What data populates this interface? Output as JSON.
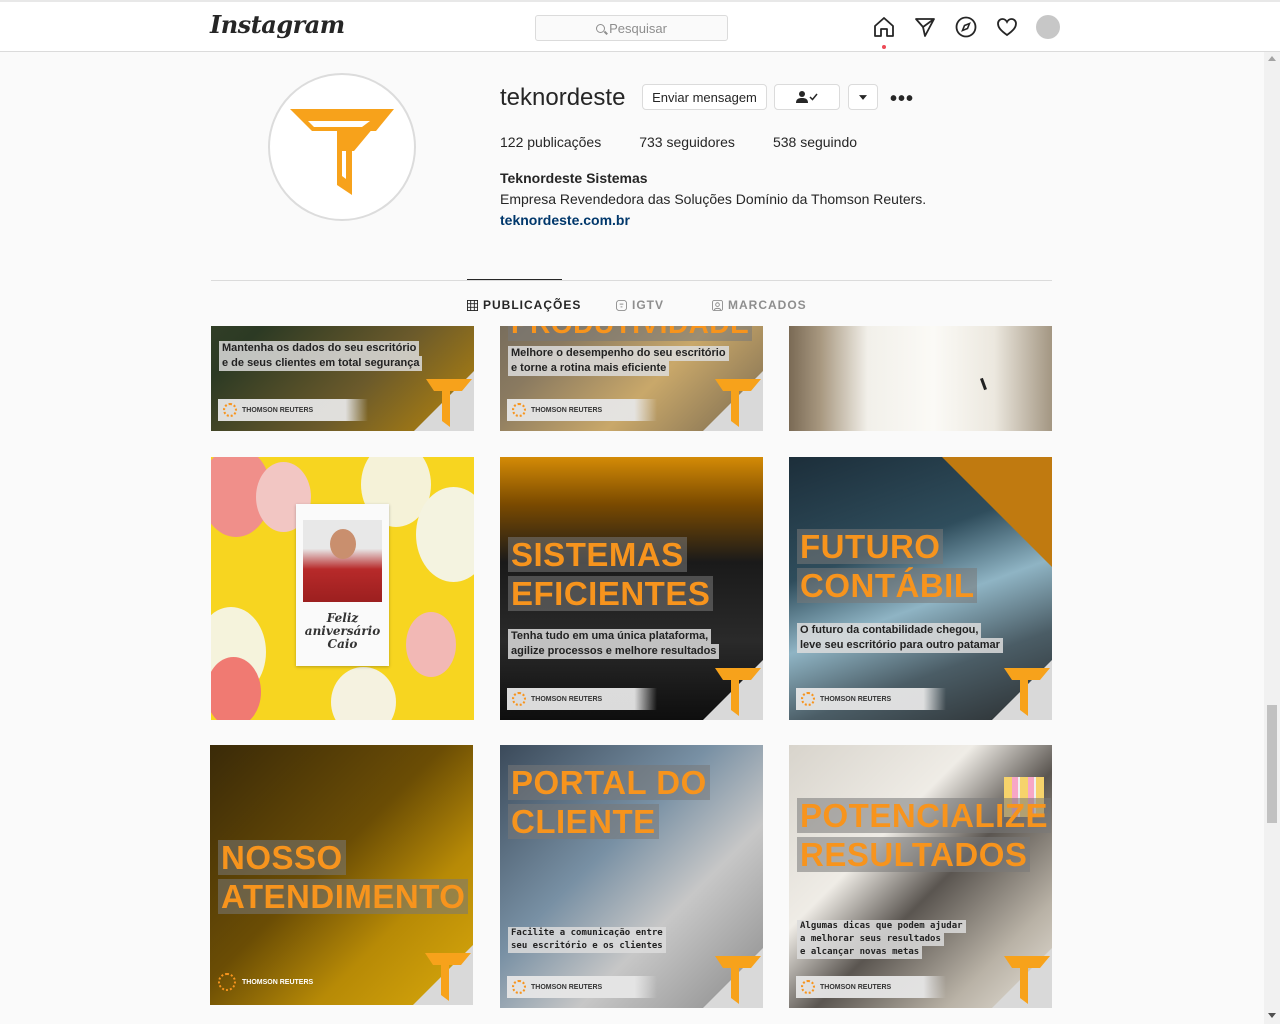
{
  "nav": {
    "logo": "Instagram",
    "search_placeholder": "Pesquisar",
    "icons": [
      "home-icon",
      "direct-icon",
      "explore-icon",
      "heart-icon",
      "profile-avatar"
    ]
  },
  "profile": {
    "username": "teknordeste",
    "message_button": "Enviar mensagem",
    "stats": {
      "posts_count": "122",
      "posts_label": "publicações",
      "followers_count": "733",
      "followers_label": "seguidores",
      "following_count": "538",
      "following_label": "seguindo"
    },
    "full_name": "Teknordeste Sistemas",
    "bio": "Empresa Revendedora das Soluções Domínio da Thomson Reuters.",
    "website": "teknordeste.com.br"
  },
  "tabs": [
    {
      "label": "PUBLICAÇÕES",
      "active": true
    },
    {
      "label": "IGTV",
      "active": false
    },
    {
      "label": "MARCADOS",
      "active": false
    }
  ],
  "brand": {
    "orange": "#f7941d",
    "tr_label": "THOMSON REUTERS"
  },
  "posts": [
    {
      "title": [],
      "subtitle": [
        "Mantenha os dados do seu escritório",
        "e de seus clientes em total segurança"
      ]
    },
    {
      "title": [
        "PRODUTIVIDADE"
      ],
      "subtitle": [
        "Melhore o desempenho do seu escritório",
        "e torne a rotina mais eficiente"
      ]
    },
    {
      "title": [],
      "subtitle": []
    },
    {
      "title": [],
      "subtitle": [],
      "card_text": [
        "Feliz",
        "aniversário",
        "Caio"
      ]
    },
    {
      "title": [
        "SISTEMAS",
        "EFICIENTES"
      ],
      "subtitle": [
        "Tenha tudo em uma única plataforma,",
        "agilize processos e melhore resultados"
      ]
    },
    {
      "title": [
        "FUTURO",
        "CONTÁBIL"
      ],
      "subtitle": [
        "O futuro da contabilidade chegou,",
        "leve seu escritório para outro patamar"
      ]
    },
    {
      "title": [
        "NOSSO",
        "ATENDIMENTO"
      ],
      "subtitle": []
    },
    {
      "title": [
        "PORTAL DO",
        "CLIENTE"
      ],
      "subtitle": [
        "Facilite a comunicação entre",
        "seu escritório e os clientes"
      ]
    },
    {
      "title": [
        "POTENCIALIZE",
        "RESULTADOS"
      ],
      "subtitle": [
        "Algumas dicas que podem ajudar",
        "a melhorar seus resultados",
        "e alcançar novas metas"
      ]
    }
  ]
}
